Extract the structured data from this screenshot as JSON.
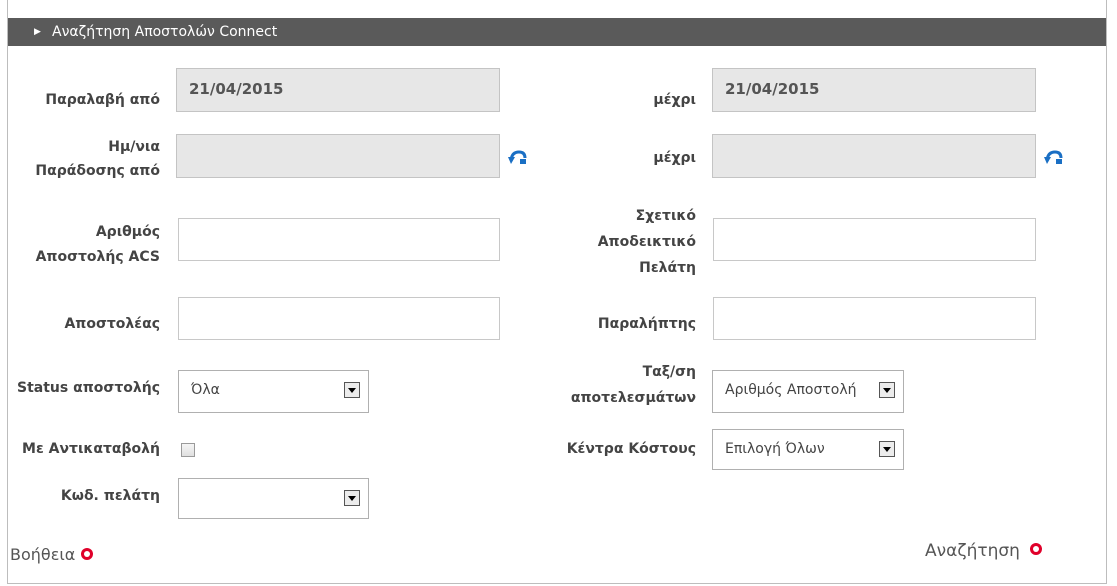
{
  "title": "Αναζήτηση Αποστολών Connect",
  "pickup_from": {
    "label": "Παραλαβή από",
    "value": "21/04/2015"
  },
  "pickup_to": {
    "label": "μέχρι",
    "value": "21/04/2015"
  },
  "delivery_from": {
    "label1": "Ημ/νια",
    "label2": "Παράδοσης από",
    "value": ""
  },
  "delivery_to": {
    "label": "μέχρι",
    "value": ""
  },
  "acs_number": {
    "label1": "Αριθμός",
    "label2": "Αποστολής ACS",
    "value": ""
  },
  "customer_ref": {
    "label1": "Σχετικό",
    "label2": "Αποδεικτικό",
    "label3": "Πελάτη",
    "value": ""
  },
  "sender": {
    "label": "Αποστολέας",
    "value": ""
  },
  "recipient": {
    "label": "Παραλήπτης",
    "value": ""
  },
  "status": {
    "label": "Status αποστολής",
    "selected": "Όλα"
  },
  "sort": {
    "label1": "Ταξ/ση",
    "label2": "αποτελεσμάτων",
    "selected": "Αριθμός Αποστολή"
  },
  "cod": {
    "label": "Με Αντικαταβολή",
    "checked": false
  },
  "cost_centers": {
    "label": "Κέντρα Κόστους",
    "selected": "Επιλογή Όλων"
  },
  "customer_code": {
    "label": "Κωδ. πελάτη",
    "selected": ""
  },
  "help": "Βοήθεια",
  "search": "Αναζήτηση",
  "icons": {
    "undo": "undo-arrow-icon",
    "header_arrow": "triangle-right-icon",
    "link_dot": "red-circle-icon"
  },
  "colors": {
    "header_bg": "#5a5a5a",
    "accent_red": "#e0002a",
    "readonly_bg": "#e7e7e7"
  }
}
